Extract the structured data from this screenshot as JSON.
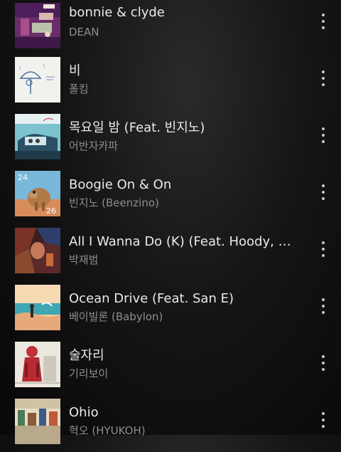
{
  "tracks": [
    {
      "title": "bonnie & clyde",
      "artist": "DEAN",
      "art_icon": "album-art-bonnie-clyde"
    },
    {
      "title": "비",
      "artist": "폴킴",
      "art_icon": "album-art-bi"
    },
    {
      "title": "목요일 밤 (Feat. 빈지노)",
      "artist": "어반자카파",
      "art_icon": "album-art-thursday-night"
    },
    {
      "title": "Boogie On & On",
      "artist": "빈지노 (Beenzino)",
      "art_icon": "album-art-24-26"
    },
    {
      "title": "All I Wanna Do (K) (Feat. Hoody, Loco)",
      "artist": "박재범",
      "art_icon": "album-art-all-i-wanna-do"
    },
    {
      "title": "Ocean Drive (Feat. San E)",
      "artist": "베이빌론 (Babylon)",
      "art_icon": "album-art-ocean-drive"
    },
    {
      "title": "술자리",
      "artist": "기리보이",
      "art_icon": "album-art-suljari"
    },
    {
      "title": "Ohio",
      "artist": "혁오 (HYUKOH)",
      "art_icon": "album-art-ohio"
    }
  ],
  "art_text": {
    "track_4_left": "24",
    "track_4_right": "26"
  },
  "more_icon": "more-vertical-icon",
  "colors": {
    "title": "#eaeaea",
    "artist": "#8e8e8e",
    "background": "#151515"
  }
}
